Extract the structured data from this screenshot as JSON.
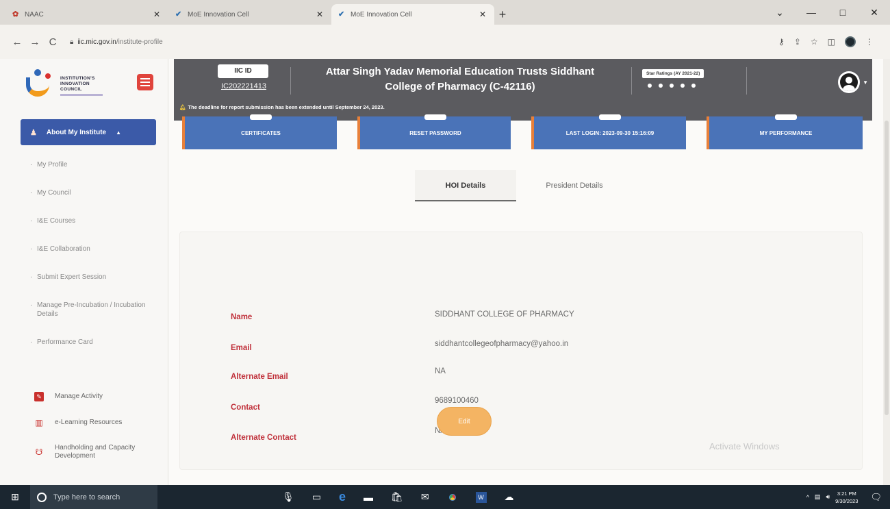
{
  "browser": {
    "tabs": [
      {
        "title": "NAAC",
        "active": false
      },
      {
        "title": "MoE Innovation Cell",
        "active": false
      },
      {
        "title": "MoE Innovation Cell",
        "active": true
      }
    ],
    "url_host": "iic.mic.gov.in",
    "url_path": "/institute-profile",
    "new_tab": "+",
    "controls": [
      "⌄",
      "—",
      "□",
      "✕"
    ]
  },
  "sidebar": {
    "logo_lines": [
      "INSTITUTION'S",
      "INNOVATION",
      "COUNCIL"
    ],
    "about_label": "About My Institute",
    "menu": [
      "My Profile",
      "My Council",
      "I&E Courses",
      "I&E Collaboration",
      "Submit Expert Session",
      "Manage Pre-Incubation / Incubation Details",
      "Performance Card"
    ],
    "menu2": [
      {
        "label": "Manage Activity",
        "icon": "pencil-box-icon"
      },
      {
        "label": "e-Learning Resources",
        "icon": "books-icon"
      },
      {
        "label": "Handholding and Capacity Development",
        "icon": "handshake-icon"
      }
    ]
  },
  "header": {
    "iic_label": "IIC ID",
    "iic_value": "IC202221413",
    "title_line1": "Attar Singh Yadav Memorial Education Trusts Siddhant",
    "title_line2": "College of Pharmacy (C-42116)",
    "star_label": "Star Ratings (AY 2021-22)",
    "star_count": 5,
    "deadline": "The deadline for report submission has been extended until September 24, 2023."
  },
  "cards": [
    {
      "label": "CERTIFICATES"
    },
    {
      "label": "RESET PASSWORD"
    },
    {
      "label": "LAST LOGIN: 2023-09-30 15:16:09"
    },
    {
      "label": "MY PERFORMANCE"
    }
  ],
  "detail_tabs": {
    "hoi": "HOI Details",
    "president": "President Details"
  },
  "details": [
    {
      "key": "Name",
      "value": "SIDDHANT COLLEGE OF PHARMACY"
    },
    {
      "key": "Email",
      "value": "siddhantcollegeofpharmacy@yahoo.in"
    },
    {
      "key": "Alternate Email",
      "value": "NA"
    },
    {
      "key": "Contact",
      "value": "9689100460"
    },
    {
      "key": "Alternate Contact",
      "value": "NA"
    }
  ],
  "edit_label": "Edit",
  "watermark": "Activate Windows",
  "taskbar": {
    "search_placeholder": "Type here to search",
    "time": "3:21 PM",
    "date": "9/30/2023"
  },
  "colors": {
    "accent_blue": "#4a73b8",
    "header_gray": "#5b5b5f",
    "label_red": "#c0303a",
    "edit_orange": "#f4b463",
    "card_border": "#e8803a"
  }
}
